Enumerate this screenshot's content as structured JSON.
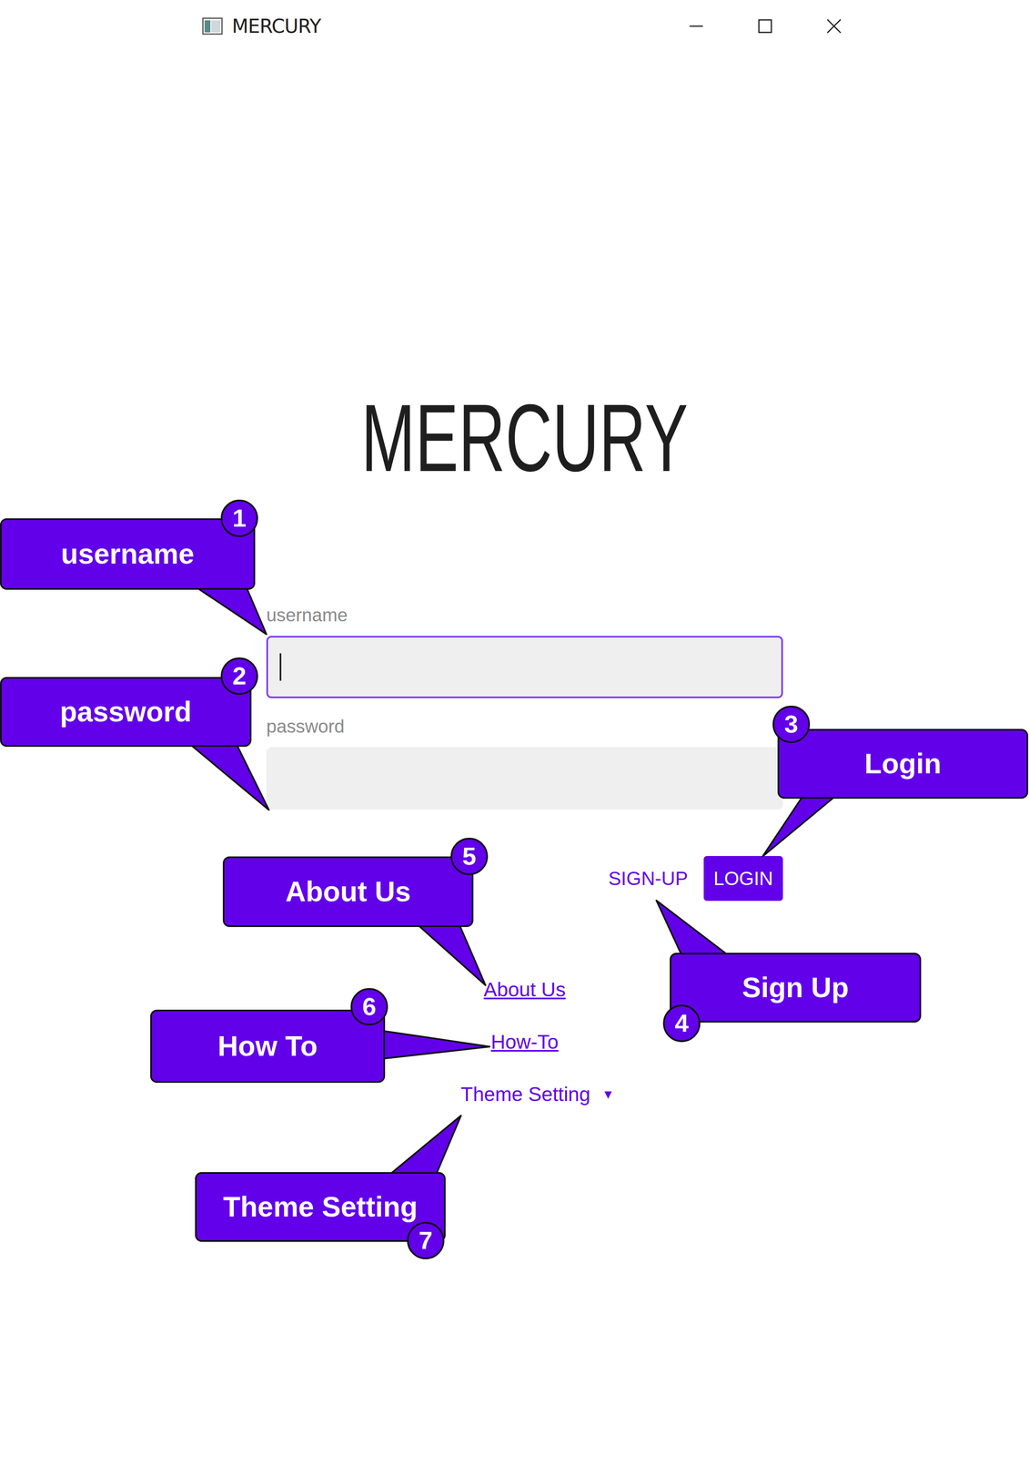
{
  "window": {
    "title": "MERCURY"
  },
  "app": {
    "heading": "MERCURY"
  },
  "fields": [
    {
      "label": "username",
      "value": "",
      "focused": true
    },
    {
      "label": "password",
      "value": "",
      "focused": false
    }
  ],
  "buttons": [
    {
      "label": "SIGN-UP",
      "kind": "text"
    },
    {
      "label": "LOGIN",
      "kind": "filled"
    }
  ],
  "links": [
    {
      "label": "About Us",
      "kind": "link",
      "icon": ""
    },
    {
      "label": "How-To",
      "kind": "link",
      "icon": ""
    },
    {
      "label": "Theme Setting",
      "kind": "dropdown",
      "icon": "▼"
    }
  ],
  "callouts": [
    {
      "number": "1",
      "label": "username"
    },
    {
      "number": "2",
      "label": "password"
    },
    {
      "number": "3",
      "label": "Login"
    },
    {
      "number": "4",
      "label": "Sign Up"
    },
    {
      "number": "5",
      "label": "About Us"
    },
    {
      "number": "6",
      "label": "How To"
    },
    {
      "number": "7",
      "label": "Theme Setting"
    }
  ]
}
